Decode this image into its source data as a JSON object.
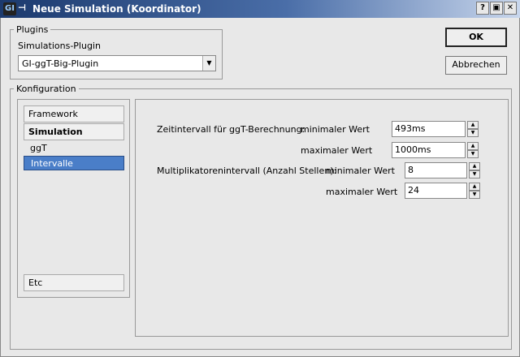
{
  "window": {
    "title": "Neue Simulation (Koordinator)",
    "app_icon": "gi-app-icon",
    "pin_glyph": "⊣",
    "buttons": {
      "help": "?",
      "maximize": "▣",
      "close": "✕"
    }
  },
  "plugins": {
    "group_label": "Plugins",
    "field_label": "Simulations-Plugin",
    "selected": "GI-ggT-Big-Plugin"
  },
  "actions": {
    "ok": "OK",
    "cancel": "Abbrechen"
  },
  "config": {
    "group_label": "Konfiguration",
    "nav": {
      "framework": "Framework",
      "simulation": "Simulation",
      "ggt": "ggT",
      "intervalle": "Intervalle",
      "etc": "Etc"
    },
    "zeit_label": "Zeitintervall für ggT-Berechnung:",
    "mult_label": "Multiplikatorenintervall (Anzahl Stellen):",
    "min_label": "minimaler Wert",
    "max_label": "maximaler Wert",
    "zeit_min": "493ms",
    "zeit_max": "1000ms",
    "mult_min": "8",
    "mult_max": "24"
  },
  "colors": {
    "selection": "#4a7ec8",
    "titlebar": "#1c3a6e"
  }
}
